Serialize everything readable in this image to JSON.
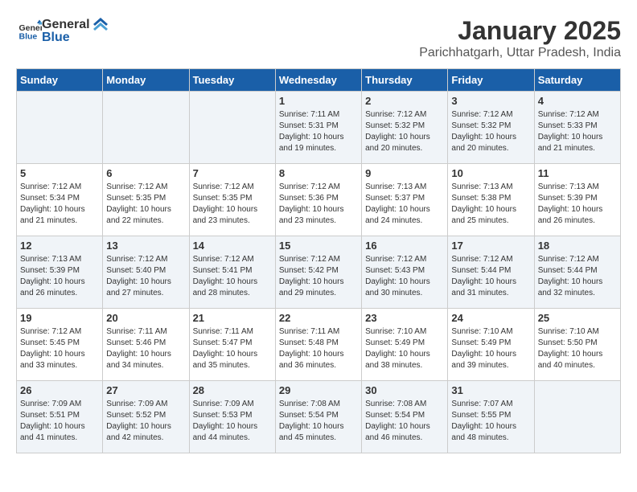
{
  "header": {
    "logo_general": "General",
    "logo_blue": "Blue",
    "title": "January 2025",
    "subtitle": "Parichhatgarh, Uttar Pradesh, India"
  },
  "weekdays": [
    "Sunday",
    "Monday",
    "Tuesday",
    "Wednesday",
    "Thursday",
    "Friday",
    "Saturday"
  ],
  "weeks": [
    [
      {
        "day": "",
        "sunrise": "",
        "sunset": "",
        "daylight": ""
      },
      {
        "day": "",
        "sunrise": "",
        "sunset": "",
        "daylight": ""
      },
      {
        "day": "",
        "sunrise": "",
        "sunset": "",
        "daylight": ""
      },
      {
        "day": "1",
        "sunrise": "Sunrise: 7:11 AM",
        "sunset": "Sunset: 5:31 PM",
        "daylight": "Daylight: 10 hours and 19 minutes."
      },
      {
        "day": "2",
        "sunrise": "Sunrise: 7:12 AM",
        "sunset": "Sunset: 5:32 PM",
        "daylight": "Daylight: 10 hours and 20 minutes."
      },
      {
        "day": "3",
        "sunrise": "Sunrise: 7:12 AM",
        "sunset": "Sunset: 5:32 PM",
        "daylight": "Daylight: 10 hours and 20 minutes."
      },
      {
        "day": "4",
        "sunrise": "Sunrise: 7:12 AM",
        "sunset": "Sunset: 5:33 PM",
        "daylight": "Daylight: 10 hours and 21 minutes."
      }
    ],
    [
      {
        "day": "5",
        "sunrise": "Sunrise: 7:12 AM",
        "sunset": "Sunset: 5:34 PM",
        "daylight": "Daylight: 10 hours and 21 minutes."
      },
      {
        "day": "6",
        "sunrise": "Sunrise: 7:12 AM",
        "sunset": "Sunset: 5:35 PM",
        "daylight": "Daylight: 10 hours and 22 minutes."
      },
      {
        "day": "7",
        "sunrise": "Sunrise: 7:12 AM",
        "sunset": "Sunset: 5:35 PM",
        "daylight": "Daylight: 10 hours and 23 minutes."
      },
      {
        "day": "8",
        "sunrise": "Sunrise: 7:12 AM",
        "sunset": "Sunset: 5:36 PM",
        "daylight": "Daylight: 10 hours and 23 minutes."
      },
      {
        "day": "9",
        "sunrise": "Sunrise: 7:13 AM",
        "sunset": "Sunset: 5:37 PM",
        "daylight": "Daylight: 10 hours and 24 minutes."
      },
      {
        "day": "10",
        "sunrise": "Sunrise: 7:13 AM",
        "sunset": "Sunset: 5:38 PM",
        "daylight": "Daylight: 10 hours and 25 minutes."
      },
      {
        "day": "11",
        "sunrise": "Sunrise: 7:13 AM",
        "sunset": "Sunset: 5:39 PM",
        "daylight": "Daylight: 10 hours and 26 minutes."
      }
    ],
    [
      {
        "day": "12",
        "sunrise": "Sunrise: 7:13 AM",
        "sunset": "Sunset: 5:39 PM",
        "daylight": "Daylight: 10 hours and 26 minutes."
      },
      {
        "day": "13",
        "sunrise": "Sunrise: 7:12 AM",
        "sunset": "Sunset: 5:40 PM",
        "daylight": "Daylight: 10 hours and 27 minutes."
      },
      {
        "day": "14",
        "sunrise": "Sunrise: 7:12 AM",
        "sunset": "Sunset: 5:41 PM",
        "daylight": "Daylight: 10 hours and 28 minutes."
      },
      {
        "day": "15",
        "sunrise": "Sunrise: 7:12 AM",
        "sunset": "Sunset: 5:42 PM",
        "daylight": "Daylight: 10 hours and 29 minutes."
      },
      {
        "day": "16",
        "sunrise": "Sunrise: 7:12 AM",
        "sunset": "Sunset: 5:43 PM",
        "daylight": "Daylight: 10 hours and 30 minutes."
      },
      {
        "day": "17",
        "sunrise": "Sunrise: 7:12 AM",
        "sunset": "Sunset: 5:44 PM",
        "daylight": "Daylight: 10 hours and 31 minutes."
      },
      {
        "day": "18",
        "sunrise": "Sunrise: 7:12 AM",
        "sunset": "Sunset: 5:44 PM",
        "daylight": "Daylight: 10 hours and 32 minutes."
      }
    ],
    [
      {
        "day": "19",
        "sunrise": "Sunrise: 7:12 AM",
        "sunset": "Sunset: 5:45 PM",
        "daylight": "Daylight: 10 hours and 33 minutes."
      },
      {
        "day": "20",
        "sunrise": "Sunrise: 7:11 AM",
        "sunset": "Sunset: 5:46 PM",
        "daylight": "Daylight: 10 hours and 34 minutes."
      },
      {
        "day": "21",
        "sunrise": "Sunrise: 7:11 AM",
        "sunset": "Sunset: 5:47 PM",
        "daylight": "Daylight: 10 hours and 35 minutes."
      },
      {
        "day": "22",
        "sunrise": "Sunrise: 7:11 AM",
        "sunset": "Sunset: 5:48 PM",
        "daylight": "Daylight: 10 hours and 36 minutes."
      },
      {
        "day": "23",
        "sunrise": "Sunrise: 7:10 AM",
        "sunset": "Sunset: 5:49 PM",
        "daylight": "Daylight: 10 hours and 38 minutes."
      },
      {
        "day": "24",
        "sunrise": "Sunrise: 7:10 AM",
        "sunset": "Sunset: 5:49 PM",
        "daylight": "Daylight: 10 hours and 39 minutes."
      },
      {
        "day": "25",
        "sunrise": "Sunrise: 7:10 AM",
        "sunset": "Sunset: 5:50 PM",
        "daylight": "Daylight: 10 hours and 40 minutes."
      }
    ],
    [
      {
        "day": "26",
        "sunrise": "Sunrise: 7:09 AM",
        "sunset": "Sunset: 5:51 PM",
        "daylight": "Daylight: 10 hours and 41 minutes."
      },
      {
        "day": "27",
        "sunrise": "Sunrise: 7:09 AM",
        "sunset": "Sunset: 5:52 PM",
        "daylight": "Daylight: 10 hours and 42 minutes."
      },
      {
        "day": "28",
        "sunrise": "Sunrise: 7:09 AM",
        "sunset": "Sunset: 5:53 PM",
        "daylight": "Daylight: 10 hours and 44 minutes."
      },
      {
        "day": "29",
        "sunrise": "Sunrise: 7:08 AM",
        "sunset": "Sunset: 5:54 PM",
        "daylight": "Daylight: 10 hours and 45 minutes."
      },
      {
        "day": "30",
        "sunrise": "Sunrise: 7:08 AM",
        "sunset": "Sunset: 5:54 PM",
        "daylight": "Daylight: 10 hours and 46 minutes."
      },
      {
        "day": "31",
        "sunrise": "Sunrise: 7:07 AM",
        "sunset": "Sunset: 5:55 PM",
        "daylight": "Daylight: 10 hours and 48 minutes."
      },
      {
        "day": "",
        "sunrise": "",
        "sunset": "",
        "daylight": ""
      }
    ]
  ]
}
